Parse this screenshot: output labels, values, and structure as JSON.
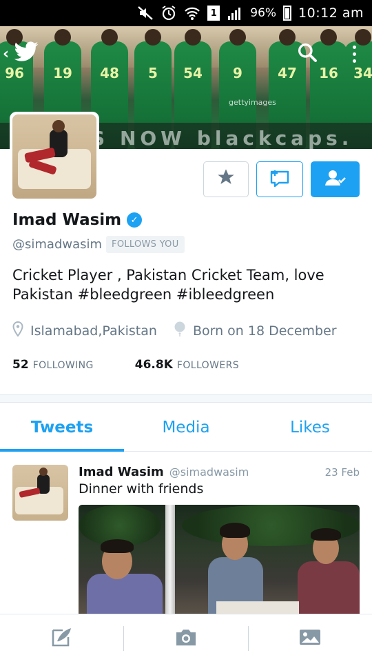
{
  "status_bar": {
    "battery_percent": "96%",
    "sim_slot": "1",
    "time": "10:12 am"
  },
  "banner": {
    "jersey_numbers": [
      "96",
      "19",
      "48",
      "5",
      "54",
      "9",
      "47",
      "16",
      "34"
    ],
    "board_text": "CKETS NOW  blackcaps.",
    "watermark": "gettyimages"
  },
  "nav": {
    "back_icon": "chevron-left-icon",
    "app_icon": "twitter-bird-icon",
    "search_icon": "search-icon",
    "more_icon": "more-vertical-icon"
  },
  "profile": {
    "display_name": "Imad Wasim",
    "verified": true,
    "handle": "@simadwasim",
    "follows_you_label": "FOLLOWS YOU",
    "bio": "Cricket Player , Pakistan Cricket Team, love Pakistan #bleedgreen #ibleedgreen",
    "location": "Islamabad,Pakistan",
    "birthday": "Born on 18 December",
    "following_count": "52",
    "following_label": "FOLLOWING",
    "followers_count": "46.8K",
    "followers_label": "FOLLOWERS"
  },
  "actions": {
    "favorite_icon": "star-icon",
    "message_icon": "direct-message-icon",
    "following_icon": "following-user-icon",
    "accent_color": "#1da1f2"
  },
  "tabs": [
    {
      "label": "Tweets",
      "active": true
    },
    {
      "label": "Media",
      "active": false
    },
    {
      "label": "Likes",
      "active": false
    }
  ],
  "tweet": {
    "name": "Imad Wasim",
    "handle": "@simadwasim",
    "date": "23 Feb",
    "text": "Dinner with friends"
  },
  "bottom_bar": {
    "compose_icon": "compose-tweet-icon",
    "camera_icon": "camera-icon",
    "gallery_icon": "image-gallery-icon"
  }
}
